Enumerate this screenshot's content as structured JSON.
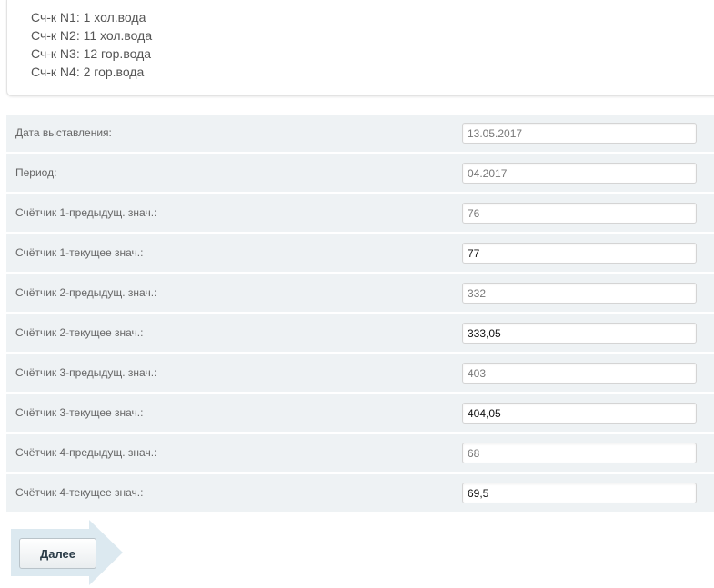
{
  "meters": [
    "Сч-к N1: 1 хол.вода",
    "Сч-к N2: 11 хол.вода",
    "Сч-к N3: 12 гор.вода",
    "Сч-к N4: 2 гор.вода"
  ],
  "form": {
    "rows": [
      {
        "label": "Дата выставления:",
        "value": "13.05.2017"
      },
      {
        "label": "Период:",
        "value": "04.2017"
      },
      {
        "label": "Счётчик 1-предыдущ. знач.:",
        "value": "76"
      },
      {
        "label": "Счётчик 1-текущее знач.:",
        "value": "77"
      },
      {
        "label": "Счётчик 2-предыдущ. знач.:",
        "value": "332"
      },
      {
        "label": "Счётчик 2-текущее знач.:",
        "value": "333,05"
      },
      {
        "label": "Счётчик 3-предыдущ. знач.:",
        "value": "403"
      },
      {
        "label": "Счётчик 3-текущее знач.:",
        "value": "404,05"
      },
      {
        "label": "Счётчик 4-предыдущ. знач.:",
        "value": "68"
      },
      {
        "label": "Счётчик 4-текущее знач.:",
        "value": "69,5"
      }
    ]
  },
  "next_button": {
    "label": "Далее"
  },
  "colors": {
    "row_background": "#eef2f4",
    "arrow": "#dce9f0"
  }
}
